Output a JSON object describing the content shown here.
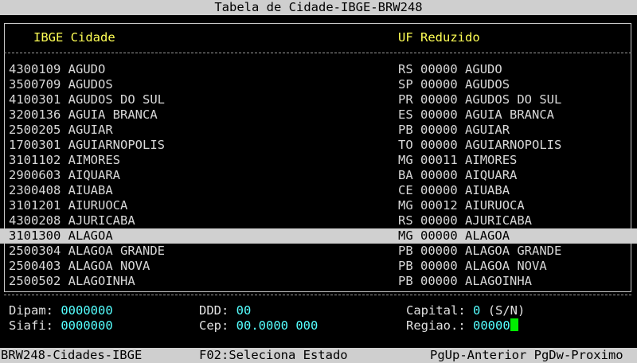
{
  "title": "Tabela de Cidade-IBGE-BRW248",
  "header": {
    "left": "IBGE Cidade",
    "right": "UF Reduzido"
  },
  "rows": [
    {
      "ibge": "4300109",
      "cidade": "AGUDO",
      "uf": "RS",
      "reduzido": "00000",
      "nome": "AGUDO"
    },
    {
      "ibge": "3500709",
      "cidade": "AGUDOS",
      "uf": "SP",
      "reduzido": "00000",
      "nome": "AGUDOS"
    },
    {
      "ibge": "4100301",
      "cidade": "AGUDOS DO SUL",
      "uf": "PR",
      "reduzido": "00000",
      "nome": "AGUDOS DO SUL"
    },
    {
      "ibge": "3200136",
      "cidade": "AGUIA BRANCA",
      "uf": "ES",
      "reduzido": "00000",
      "nome": "AGUIA BRANCA"
    },
    {
      "ibge": "2500205",
      "cidade": "AGUIAR",
      "uf": "PB",
      "reduzido": "00000",
      "nome": "AGUIAR"
    },
    {
      "ibge": "1700301",
      "cidade": "AGUIARNOPOLIS",
      "uf": "TO",
      "reduzido": "00000",
      "nome": "AGUIARNOPOLIS"
    },
    {
      "ibge": "3101102",
      "cidade": "AIMORES",
      "uf": "MG",
      "reduzido": "00011",
      "nome": "AIMORES"
    },
    {
      "ibge": "2900603",
      "cidade": "AIQUARA",
      "uf": "BA",
      "reduzido": "00000",
      "nome": "AIQUARA"
    },
    {
      "ibge": "2300408",
      "cidade": "AIUABA",
      "uf": "CE",
      "reduzido": "00000",
      "nome": "AIUABA"
    },
    {
      "ibge": "3101201",
      "cidade": "AIURUOCA",
      "uf": "MG",
      "reduzido": "00012",
      "nome": "AIURUOCA"
    },
    {
      "ibge": "4300208",
      "cidade": "AJURICABA",
      "uf": "RS",
      "reduzido": "00000",
      "nome": "AJURICABA"
    },
    {
      "ibge": "3101300",
      "cidade": "ALAGOA",
      "uf": "MG",
      "reduzido": "00000",
      "nome": "ALAGOA"
    },
    {
      "ibge": "2500304",
      "cidade": "ALAGOA GRANDE",
      "uf": "PB",
      "reduzido": "00000",
      "nome": "ALAGOA GRANDE"
    },
    {
      "ibge": "2500403",
      "cidade": "ALAGOA NOVA",
      "uf": "PB",
      "reduzido": "00000",
      "nome": "ALAGOA NOVA"
    },
    {
      "ibge": "2500502",
      "cidade": "ALAGOINHA",
      "uf": "PB",
      "reduzido": "00000",
      "nome": "ALAGOINHA"
    }
  ],
  "selected_ibge": "3101300",
  "fields": {
    "dipam": {
      "label": "Dipam:",
      "value": "0000000"
    },
    "siafi": {
      "label": "Siafi:",
      "value": "0000000"
    },
    "ddd": {
      "label": "DDD:",
      "value": "00"
    },
    "cep": {
      "label": "Cep:",
      "value": "00.0000 000"
    },
    "capital": {
      "label": "Capital:",
      "value": "0",
      "hint": "(S/N)"
    },
    "regiao": {
      "label": "Regiao.:",
      "value": "00000"
    }
  },
  "status": {
    "program": "BRW248-Cidades-IBGE",
    "f02": "F02:Seleciona Estado",
    "paging": "PgUp-Anterior PgDw-Proximo"
  }
}
